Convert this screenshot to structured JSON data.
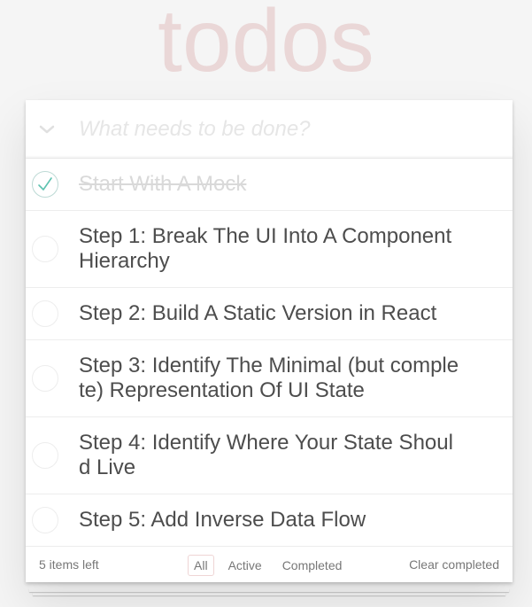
{
  "app": {
    "title": "todos"
  },
  "header": {
    "toggle_all_icon": "chevron-down-icon",
    "new_todo_placeholder": "What needs to be done?"
  },
  "todos": [
    {
      "label": "Start With A Mock",
      "completed": true
    },
    {
      "label": "Step 1: Break The UI Into A Component Hierarchy",
      "completed": false
    },
    {
      "label": "Step 2: Build A Static Version in React",
      "completed": false
    },
    {
      "label": "Step 3: Identify The Minimal (but complete) Representation Of UI State",
      "completed": false
    },
    {
      "label": "Step 4: Identify Where Your State Should Live",
      "completed": false
    },
    {
      "label": "Step 5: Add Inverse Data Flow",
      "completed": false
    }
  ],
  "footer": {
    "items_left": "5 items left",
    "filters": {
      "all": "All",
      "active": "Active",
      "completed": "Completed"
    },
    "selected_filter": "All",
    "clear_completed": "Clear completed"
  },
  "colors": {
    "title": "#f0dcdc",
    "check_done": "#5dc2af",
    "background": "#f5f5f5"
  }
}
